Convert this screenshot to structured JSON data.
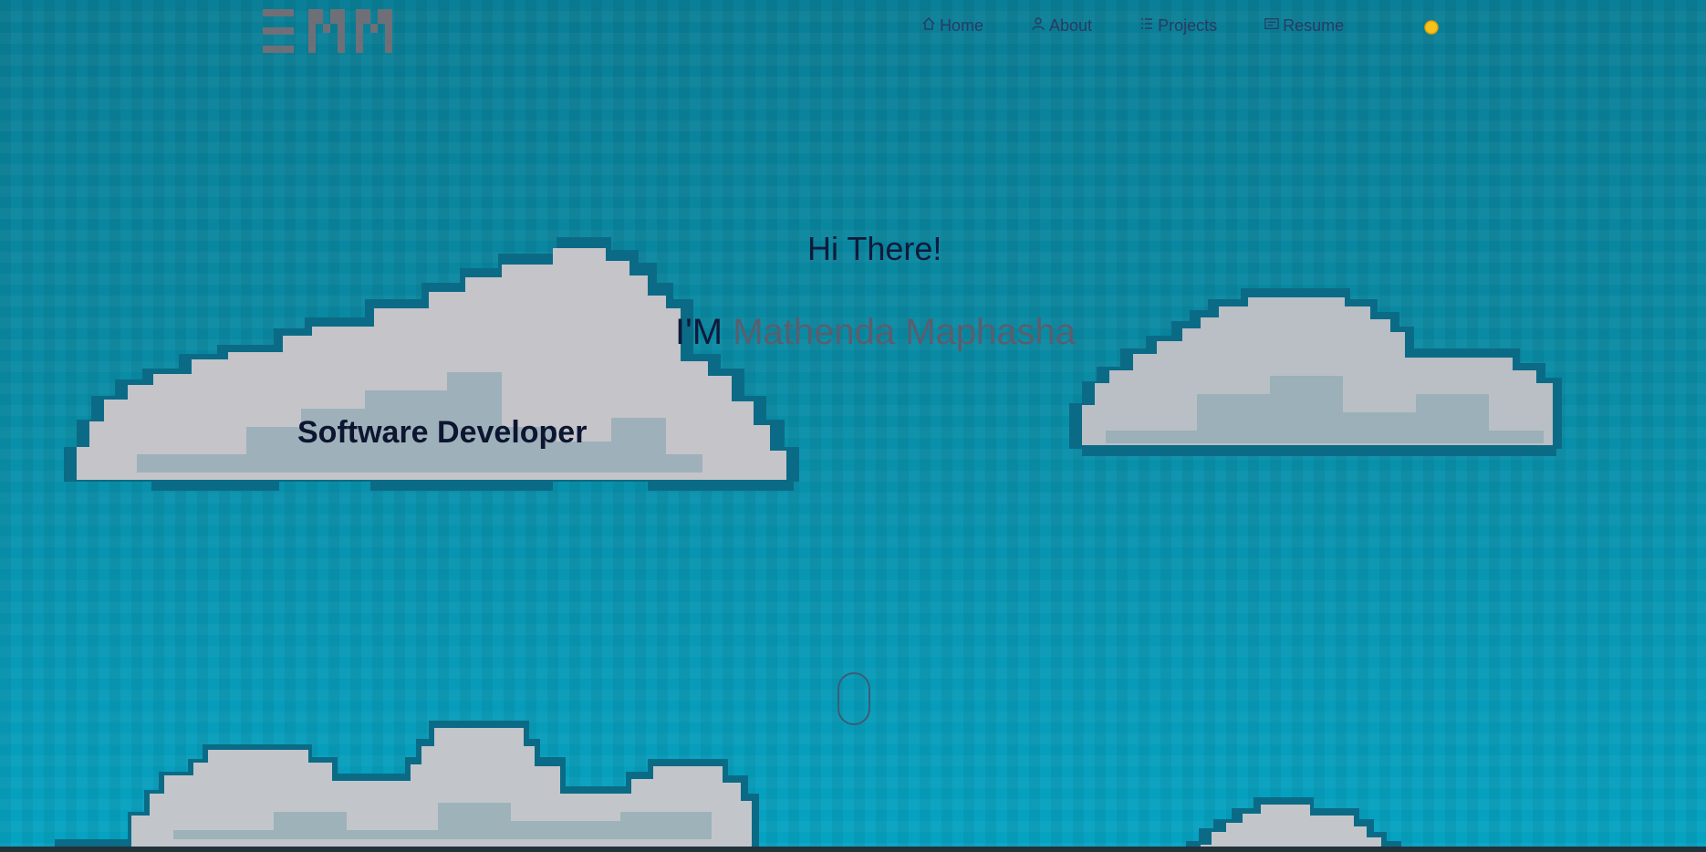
{
  "nav": {
    "logo_text": "EMM",
    "items": [
      {
        "label": "Home",
        "icon": "home-icon"
      },
      {
        "label": "About",
        "icon": "user-icon"
      },
      {
        "label": "Projects",
        "icon": "list-icon"
      },
      {
        "label": "Resume",
        "icon": "document-icon"
      }
    ],
    "theme_icon": "sun-icon"
  },
  "hero": {
    "greeting": "Hi There!",
    "name_prefix": "I'M ",
    "name": "Mathenda Maphasha",
    "role": "Software Developer"
  },
  "colors": {
    "sky_top": "#0a7f97",
    "sky_bottom": "#06a3c2",
    "text_dark": "#101a3a",
    "name_accent": "#5a5e6e",
    "nav_text": "#2b3a63",
    "logo": "#6f6f78",
    "cloud_light": "#c8c8cc",
    "cloud_shadow": "#8aaab4",
    "cloud_outline": "#0b6b86",
    "sun": "#f7c21a"
  }
}
